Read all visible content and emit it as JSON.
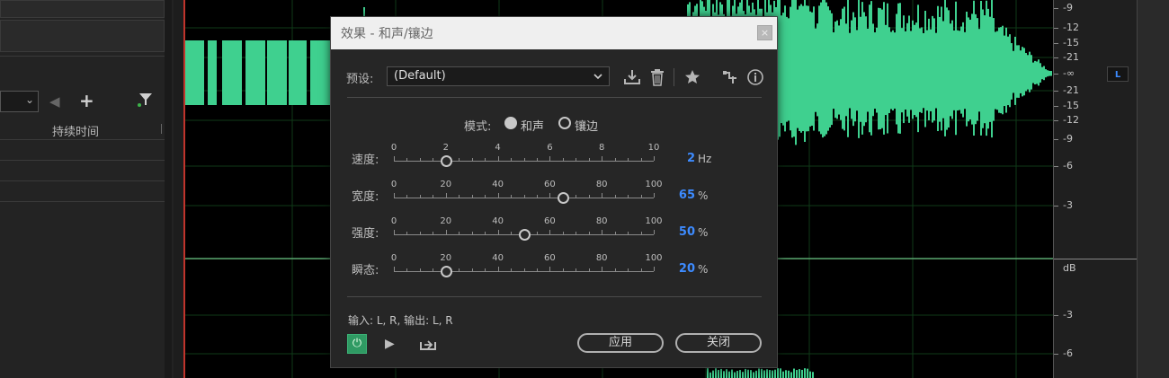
{
  "left_panel": {
    "duration_header": "持续时间",
    "select_chevron": "⌄",
    "icons": [
      "back-arrow-icon",
      "add-icon",
      "filter-icon"
    ]
  },
  "ruler": {
    "top_labels": [
      "-9",
      "-12",
      "-15",
      "-21",
      "-∞",
      "-21",
      "-15",
      "-12",
      "-9",
      "-6",
      "-3"
    ],
    "unit": "dB",
    "bottom_labels": [
      "-3",
      "-6"
    ],
    "channel": "L"
  },
  "dialog": {
    "title": "效果 - 和声/镶边",
    "close_glyph": "×",
    "preset_label": "预设:",
    "preset_value": "(Default)",
    "toolbar_icons": [
      "save-preset-icon",
      "delete-preset-icon",
      "favorite-star-icon",
      "routing-icon",
      "info-icon"
    ],
    "mode_label": "模式:",
    "mode_options": [
      "和声",
      "镶边"
    ],
    "mode_selected": "和声",
    "sliders": [
      {
        "label": "速度:",
        "ticks": [
          "0",
          "2",
          "4",
          "6",
          "8",
          "10"
        ],
        "min": 0,
        "max": 10,
        "value_text": "2",
        "value": 2,
        "unit": "Hz"
      },
      {
        "label": "宽度:",
        "ticks": [
          "0",
          "20",
          "40",
          "60",
          "80",
          "100"
        ],
        "min": 0,
        "max": 100,
        "value_text": "65",
        "value": 65,
        "unit": "%"
      },
      {
        "label": "强度:",
        "ticks": [
          "0",
          "20",
          "40",
          "60",
          "80",
          "100"
        ],
        "min": 0,
        "max": 100,
        "value_text": "50",
        "value": 50,
        "unit": "%"
      },
      {
        "label": "瞬态:",
        "ticks": [
          "0",
          "20",
          "40",
          "60",
          "80",
          "100"
        ],
        "min": 0,
        "max": 100,
        "value_text": "20",
        "value": 20,
        "unit": "%"
      }
    ],
    "io_text": "输入: L, R,   输出: L, R",
    "power_glyph": "⏻",
    "play_glyph": "▶",
    "apply_label": "应用",
    "close_label": "关闭"
  },
  "colors": {
    "waveform": "#3fd08f",
    "accent_blue": "#3d8bff",
    "power_green": "#2f9a63",
    "playhead": "#c0342c"
  }
}
